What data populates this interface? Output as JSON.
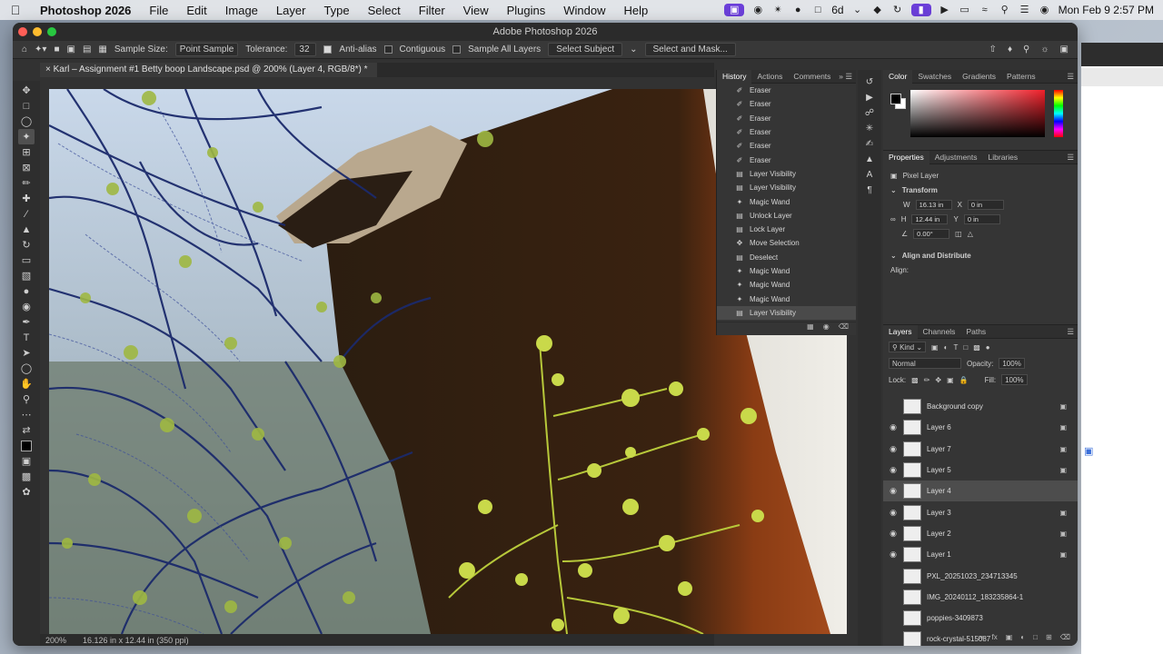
{
  "menubar": {
    "app": "Photoshop 2026",
    "items": [
      "File",
      "Edit",
      "Image",
      "Layer",
      "Type",
      "Select",
      "Filter",
      "View",
      "Plugins",
      "Window",
      "Help"
    ],
    "status_badge": "6d",
    "datetime": "Mon Feb 9  2:57 PM"
  },
  "window": {
    "title": "Adobe Photoshop 2026",
    "colors": {
      "close": "#ff5f57",
      "minimize": "#febc2e",
      "zoom": "#28c840"
    }
  },
  "options_bar": {
    "sample_size_label": "Sample Size:",
    "sample_size_value": "Point Sample",
    "tolerance_label": "Tolerance:",
    "tolerance_value": "32",
    "anti_alias": "Anti-alias",
    "contiguous": "Contiguous",
    "sample_all_layers": "Sample All Layers",
    "select_subject": "Select Subject",
    "select_and_mask": "Select and Mask..."
  },
  "document": {
    "tab_title": "Karl – Assignment #1 Betty boop Landscape.psd @ 200% (Layer 4, RGB/8*) *",
    "zoom": "200%",
    "doc_size": "16.126 in x 12.44 in (350 ppi)"
  },
  "history_panel": {
    "tabs": [
      "History",
      "Actions",
      "Comments"
    ],
    "items": [
      {
        "label": "Eraser",
        "icon": "eraser-icon"
      },
      {
        "label": "Eraser",
        "icon": "eraser-icon"
      },
      {
        "label": "Eraser",
        "icon": "eraser-icon"
      },
      {
        "label": "Eraser",
        "icon": "eraser-icon"
      },
      {
        "label": "Eraser",
        "icon": "eraser-icon"
      },
      {
        "label": "Eraser",
        "icon": "eraser-icon"
      },
      {
        "label": "Layer Visibility",
        "icon": "layer-icon"
      },
      {
        "label": "Layer Visibility",
        "icon": "layer-icon"
      },
      {
        "label": "Magic Wand",
        "icon": "wand-icon"
      },
      {
        "label": "Unlock Layer",
        "icon": "layer-icon"
      },
      {
        "label": "Lock Layer",
        "icon": "layer-icon"
      },
      {
        "label": "Move Selection",
        "icon": "move-icon"
      },
      {
        "label": "Deselect",
        "icon": "layer-icon"
      },
      {
        "label": "Magic Wand",
        "icon": "wand-icon"
      },
      {
        "label": "Magic Wand",
        "icon": "wand-icon"
      },
      {
        "label": "Magic Wand",
        "icon": "wand-icon"
      },
      {
        "label": "Layer Visibility",
        "icon": "layer-icon"
      }
    ],
    "selected_index": 16
  },
  "color_panel": {
    "tabs": [
      "Color",
      "Swatches",
      "Gradients",
      "Patterns"
    ],
    "foreground": "#000000",
    "background": "#ffffff",
    "hue_color": "#f0202a"
  },
  "properties_panel": {
    "tabs": [
      "Properties",
      "Adjustments",
      "Libraries"
    ],
    "layer_type": "Pixel Layer",
    "transform_label": "Transform",
    "w_label": "W",
    "w_value": "16.13 in",
    "h_label": "H",
    "h_value": "12.44 in",
    "x_label": "X",
    "x_value": "0 in",
    "y_label": "Y",
    "y_value": "0 in",
    "angle_value": "0.00°",
    "align_label": "Align and Distribute",
    "align_sub": "Align:"
  },
  "layers_panel": {
    "tabs": [
      "Layers",
      "Channels",
      "Paths"
    ],
    "kind_label": "Kind",
    "blend_mode": "Normal",
    "opacity_label": "Opacity:",
    "opacity_value": "100%",
    "lock_label": "Lock:",
    "fill_label": "Fill:",
    "fill_value": "100%",
    "layers": [
      {
        "name": "Background copy",
        "visible": false,
        "locked": true
      },
      {
        "name": "Layer 6",
        "visible": true,
        "locked": true
      },
      {
        "name": "Layer 7",
        "visible": true,
        "locked": true
      },
      {
        "name": "Layer 5",
        "visible": true,
        "locked": true
      },
      {
        "name": "Layer 4",
        "visible": true,
        "locked": false
      },
      {
        "name": "Layer 3",
        "visible": true,
        "locked": true
      },
      {
        "name": "Layer 2",
        "visible": true,
        "locked": true
      },
      {
        "name": "Layer 1",
        "visible": true,
        "locked": true
      },
      {
        "name": "PXL_20251023_234713345",
        "visible": false,
        "locked": false
      },
      {
        "name": "IMG_20240112_183235864-1",
        "visible": false,
        "locked": false
      },
      {
        "name": "poppies-3409873",
        "visible": false,
        "locked": false
      },
      {
        "name": "rock-crystal-515087",
        "visible": false,
        "locked": false
      }
    ],
    "selected_index": 4
  }
}
